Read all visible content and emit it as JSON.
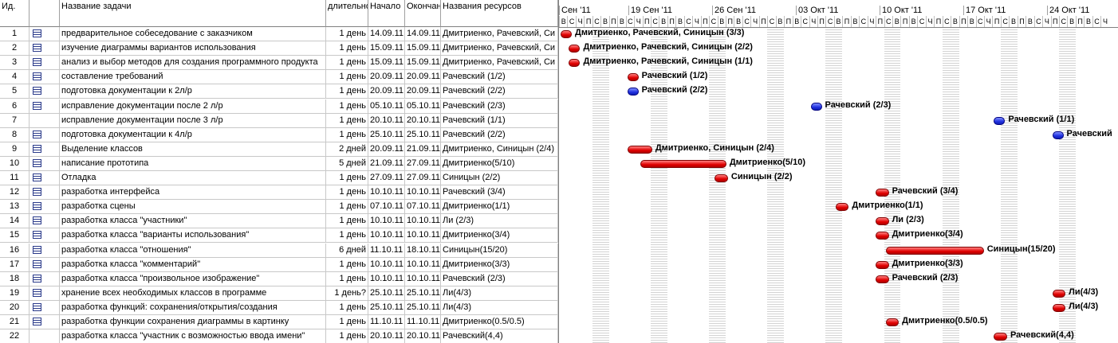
{
  "columns": {
    "id": "Ид.",
    "name": "Название задачи",
    "duration": "длительнос",
    "start": "Начало",
    "end": "Окончани",
    "resources": "Названия ресурсов"
  },
  "info_icon": "i",
  "weeks": [
    "Сен '11",
    "19 Сен '11",
    "26 Сен '11",
    "03 Окт '11",
    "10 Окт '11",
    "17 Окт '11",
    "24 Окт '11"
  ],
  "day_letters": [
    "В",
    "С",
    "Ч",
    "П",
    "С",
    "В",
    "П",
    "В",
    "С",
    "Ч",
    "П",
    "С",
    "В",
    "П",
    "В",
    "С",
    "Ч",
    "П",
    "С",
    "В",
    "П",
    "В",
    "С",
    "Ч",
    "П",
    "С",
    "В",
    "П",
    "В",
    "С",
    "Ч",
    "П",
    "С",
    "В",
    "П",
    "В",
    "С",
    "Ч",
    "П",
    "С",
    "В",
    "П",
    "В",
    "С",
    "Ч",
    "П",
    "С",
    "В",
    "П",
    "В",
    "С",
    "Ч",
    "П",
    "С",
    "В",
    "П",
    "В",
    "С",
    "Ч",
    "П",
    "С",
    "В",
    "П",
    "В",
    "С",
    "Ч"
  ],
  "rows": [
    {
      "id": "1",
      "icon": true,
      "name": "предварительное собеседование с заказчиком",
      "duration": "1 день",
      "start": "14.09.11",
      "end": "14.09.11",
      "resources": "Дмитриенко, Рачевский, Си",
      "bar": {
        "start": 0,
        "len": 1,
        "color": "red"
      },
      "label": "Дмитриенко, Рачевский, Синицын (3/3)"
    },
    {
      "id": "2",
      "icon": true,
      "name": "изучение диаграммы вариантов использования",
      "duration": "1 день",
      "start": "15.09.11",
      "end": "15.09.11",
      "resources": "Дмитриенко, Рачевский, Си",
      "bar": {
        "start": 1,
        "len": 1,
        "color": "red"
      },
      "label": "Дмитриенко, Рачевский, Синицын (2/2)"
    },
    {
      "id": "3",
      "icon": true,
      "name": "анализ и выбор методов для создания программного продукта",
      "duration": "1 день",
      "start": "15.09.11",
      "end": "15.09.11",
      "resources": "Дмитриенко, Рачевский, Си",
      "bar": {
        "start": 1,
        "len": 1,
        "color": "red"
      },
      "label": "Дмитриенко, Рачевский, Синицын (1/1)"
    },
    {
      "id": "4",
      "icon": true,
      "name": "составление требований",
      "duration": "1 день",
      "start": "20.09.11",
      "end": "20.09.11",
      "resources": "Рачевский (1/2)",
      "bar": {
        "start": 8,
        "len": 1,
        "color": "red"
      },
      "label": "Рачевский (1/2)"
    },
    {
      "id": "5",
      "icon": true,
      "name": "подготовка документации к 2л/р",
      "duration": "1 день",
      "start": "20.09.11",
      "end": "20.09.11",
      "resources": "Рачевский (2/2)",
      "bar": {
        "start": 8,
        "len": 1,
        "color": "blue"
      },
      "label": "Рачевский (2/2)"
    },
    {
      "id": "6",
      "icon": true,
      "name": "исправление документации после 2 л/р",
      "duration": "1 день",
      "start": "05.10.11",
      "end": "05.10.11",
      "resources": "Рачевский (2/3)",
      "bar": {
        "start": 30,
        "len": 1,
        "color": "blue"
      },
      "label": "Рачевский (2/3)"
    },
    {
      "id": "7",
      "icon": false,
      "name": "исправление документации после 3 л/р",
      "duration": "1 день",
      "start": "20.10.11",
      "end": "20.10.11",
      "resources": "Рачевский (1/1)",
      "bar": {
        "start": 52,
        "len": 1,
        "color": "blue"
      },
      "label": "Рачевский (1/1)"
    },
    {
      "id": "8",
      "icon": true,
      "name": "подготовка документации к 4л/р",
      "duration": "1 день",
      "start": "25.10.11",
      "end": "25.10.11",
      "resources": "Рачевский (2/2)",
      "bar": {
        "start": 59,
        "len": 1,
        "color": "blue"
      },
      "label": "Рачевский"
    },
    {
      "id": "9",
      "icon": true,
      "name": "Выделение классов",
      "duration": "2 дней",
      "start": "20.09.11",
      "end": "21.09.11",
      "resources": "Дмитриенко, Синицын (2/4)",
      "bar": {
        "start": 8,
        "len": 2.7,
        "color": "red"
      },
      "label": "Дмитриенко, Синицын (2/4)"
    },
    {
      "id": "10",
      "icon": true,
      "name": "написание прототипа",
      "duration": "5 дней",
      "start": "21.09.11",
      "end": "27.09.11",
      "resources": "Дмитриенко(5/10)",
      "bar": {
        "start": 9.6,
        "len": 10,
        "color": "red"
      },
      "label": "Дмитриенко(5/10)"
    },
    {
      "id": "11",
      "icon": true,
      "name": "Отладка",
      "duration": "1 день",
      "start": "27.09.11",
      "end": "27.09.11",
      "resources": "Синицын (2/2)",
      "bar": {
        "start": 18.5,
        "len": 1.3,
        "color": "red"
      },
      "label": "Синицын (2/2)"
    },
    {
      "id": "12",
      "icon": true,
      "name": "разработка интерфейса",
      "duration": "1 день",
      "start": "10.10.11",
      "end": "10.10.11",
      "resources": "Рачевский (3/4)",
      "bar": {
        "start": 37.8,
        "len": 1.3,
        "color": "red"
      },
      "label": "Рачевский (3/4)"
    },
    {
      "id": "13",
      "icon": true,
      "name": "разработка сцены",
      "duration": "1 день",
      "start": "07.10.11",
      "end": "07.10.11",
      "resources": "Дмитриенко(1/1)",
      "bar": {
        "start": 33,
        "len": 1.3,
        "color": "red"
      },
      "label": "Дмитриенко(1/1)"
    },
    {
      "id": "14",
      "icon": true,
      "name": "разработка класса \"участники\"",
      "duration": "1 день",
      "start": "10.10.11",
      "end": "10.10.11",
      "resources": "Ли (2/3)",
      "bar": {
        "start": 37.8,
        "len": 1.3,
        "color": "red"
      },
      "label": "Ли (2/3)"
    },
    {
      "id": "15",
      "icon": true,
      "name": "разработка класса \"варианты использования\"",
      "duration": "1 день",
      "start": "10.10.11",
      "end": "10.10.11",
      "resources": "Дмитриенко(3/4)",
      "bar": {
        "start": 37.8,
        "len": 1.3,
        "color": "red"
      },
      "label": "Дмитриенко(3/4)"
    },
    {
      "id": "16",
      "icon": true,
      "name": "разработка класса \"отношения\"",
      "duration": "6 дней",
      "start": "11.10.11",
      "end": "18.10.11",
      "resources": "Синицын(15/20)",
      "bar": {
        "start": 39,
        "len": 11.5,
        "color": "red"
      },
      "label": "Синицын(15/20)"
    },
    {
      "id": "17",
      "icon": true,
      "name": "разработка класса \"комментарий\"",
      "duration": "1 день",
      "start": "10.10.11",
      "end": "10.10.11",
      "resources": "Дмитриенко(3/3)",
      "bar": {
        "start": 37.8,
        "len": 1.3,
        "color": "red"
      },
      "label": "Дмитриенко(3/3)"
    },
    {
      "id": "18",
      "icon": true,
      "name": "разработка класса \"произвольное изображение\"",
      "duration": "1 день",
      "start": "10.10.11",
      "end": "10.10.11",
      "resources": "Рачевский (2/3)",
      "bar": {
        "start": 37.8,
        "len": 1.3,
        "color": "red"
      },
      "label": "Рачевский (2/3)"
    },
    {
      "id": "19",
      "icon": true,
      "name": "хранение всех необходимых классов в программе",
      "duration": "1 день?",
      "start": "25.10.11",
      "end": "25.10.11",
      "resources": "Ли(4/3)",
      "bar": {
        "start": 59,
        "len": 1.3,
        "color": "red"
      },
      "label": "Ли(4/3)"
    },
    {
      "id": "20",
      "icon": true,
      "name": "разработка функций: сохранения/открытия/создания",
      "duration": "1 день",
      "start": "25.10.11",
      "end": "25.10.11",
      "resources": "Ли(4/3)",
      "bar": {
        "start": 59,
        "len": 1.3,
        "color": "red"
      },
      "label": "Ли(4/3)"
    },
    {
      "id": "21",
      "icon": true,
      "name": "разработка функции сохранения диаграммы в картинку",
      "duration": "1 день",
      "start": "11.10.11",
      "end": "11.10.11",
      "resources": "Дмитриенко(0.5/0.5)",
      "bar": {
        "start": 39,
        "len": 1.3,
        "color": "red"
      },
      "label": "Дмитриенко(0.5/0.5)"
    },
    {
      "id": "22",
      "icon": false,
      "name": "разработка класса \"участник с возможностью ввода имени\"",
      "duration": "1 день",
      "start": "20.10.11",
      "end": "20.10.11",
      "resources": "Рачевский(4,4)",
      "bar": {
        "start": 52,
        "len": 1.3,
        "color": "red"
      },
      "label": "Рачевский(4,4)"
    }
  ]
}
